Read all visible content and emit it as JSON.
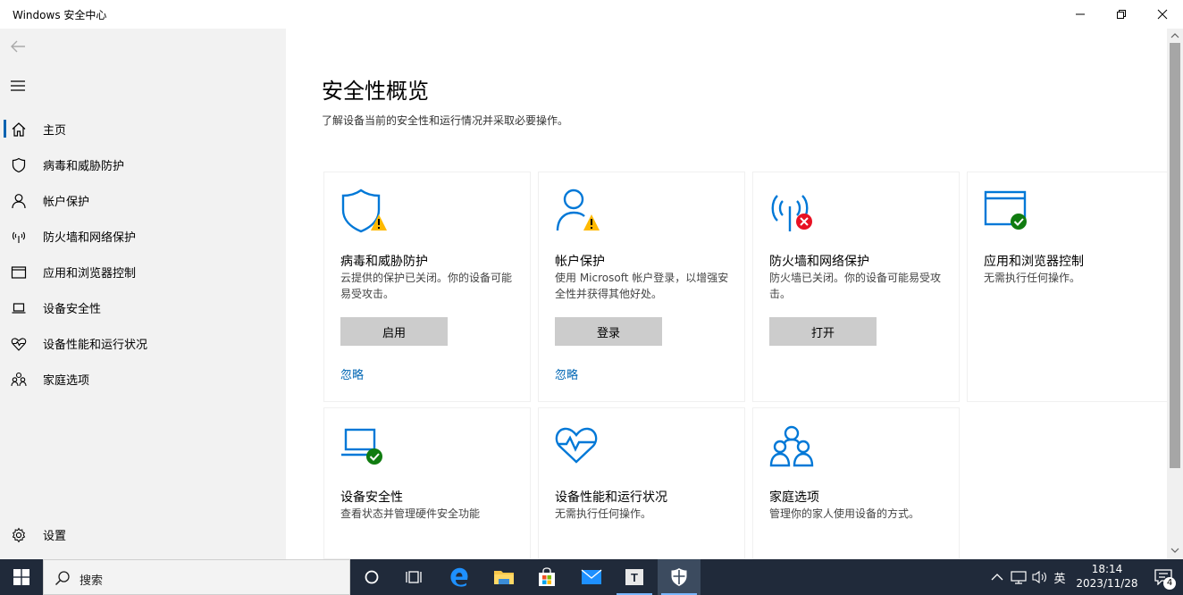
{
  "window": {
    "title": "Windows 安全中心"
  },
  "sidebar": {
    "items": [
      {
        "label": "主页",
        "icon": "home-icon",
        "selected": true
      },
      {
        "label": "病毒和威胁防护",
        "icon": "shield-icon"
      },
      {
        "label": "帐户保护",
        "icon": "person-icon"
      },
      {
        "label": "防火墙和网络保护",
        "icon": "wifi-antenna-icon"
      },
      {
        "label": "应用和浏览器控制",
        "icon": "browser-window-icon"
      },
      {
        "label": "设备安全性",
        "icon": "laptop-icon"
      },
      {
        "label": "设备性能和运行状况",
        "icon": "heart-icon"
      },
      {
        "label": "家庭选项",
        "icon": "family-icon"
      }
    ],
    "settings_label": "设置"
  },
  "main": {
    "title": "安全性概览",
    "subtitle": "了解设备当前的安全性和运行情况并采取必要操作。",
    "cards": [
      {
        "title": "病毒和威胁防护",
        "desc": "云提供的保护已关闭。你的设备可能易受攻击。",
        "button": "启用",
        "link": "忽略",
        "status": "warning"
      },
      {
        "title": "帐户保护",
        "desc": "使用 Microsoft 帐户登录，以增强安全性并获得其他好处。",
        "button": "登录",
        "link": "忽略",
        "status": "warning"
      },
      {
        "title": "防火墙和网络保护",
        "desc": "防火墙已关闭。你的设备可能易受攻击。",
        "button": "打开",
        "status": "error"
      },
      {
        "title": "应用和浏览器控制",
        "desc": "无需执行任何操作。",
        "status": "ok"
      },
      {
        "title": "设备安全性",
        "desc": "查看状态并管理硬件安全功能",
        "status": "ok"
      },
      {
        "title": "设备性能和运行状况",
        "desc": "无需执行任何操作。"
      },
      {
        "title": "家庭选项",
        "desc": "管理你的家人使用设备的方式。"
      }
    ]
  },
  "colors": {
    "accent": "#0063b1",
    "icon_blue": "#0078d7",
    "warning": "#ffb900",
    "error": "#e81123",
    "ok": "#107c10",
    "link": "#0066b4",
    "taskbar": "#202a3a"
  },
  "taskbar": {
    "search_placeholder": "搜索",
    "ime": "英",
    "time": "18:14",
    "date": "2023/11/28",
    "notification_count": "4"
  }
}
